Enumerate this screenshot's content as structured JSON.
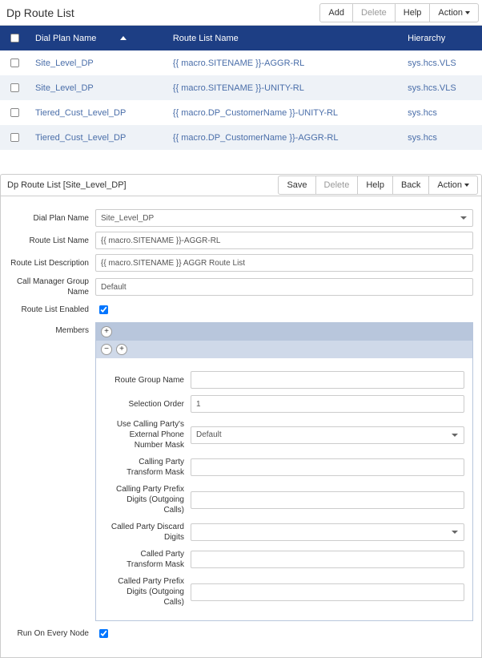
{
  "topbar": {
    "title": "Dp Route List",
    "buttons": {
      "add": "Add",
      "delete": "Delete",
      "help": "Help",
      "action": "Action"
    }
  },
  "grid": {
    "columns": {
      "dialPlan": "Dial Plan Name",
      "routeList": "Route List Name",
      "hierarchy": "Hierarchy"
    },
    "rows": [
      {
        "dialPlan": "Site_Level_DP",
        "routeList": "{{ macro.SITENAME }}-AGGR-RL",
        "hierarchy": "sys.hcs.VLS"
      },
      {
        "dialPlan": "Site_Level_DP",
        "routeList": "{{ macro.SITENAME }}-UNITY-RL",
        "hierarchy": "sys.hcs.VLS"
      },
      {
        "dialPlan": "Tiered_Cust_Level_DP",
        "routeList": "{{ macro.DP_CustomerName }}-UNITY-RL",
        "hierarchy": "sys.hcs"
      },
      {
        "dialPlan": "Tiered_Cust_Level_DP",
        "routeList": "{{ macro.DP_CustomerName }}-AGGR-RL",
        "hierarchy": "sys.hcs"
      }
    ]
  },
  "detailbar": {
    "title": "Dp Route List [Site_Level_DP]",
    "buttons": {
      "save": "Save",
      "delete": "Delete",
      "help": "Help",
      "back": "Back",
      "action": "Action"
    }
  },
  "form": {
    "labels": {
      "dialPlanName": "Dial Plan Name",
      "routeListName": "Route List Name",
      "routeListDesc": "Route List Description",
      "cmGroupName": "Call Manager Group Name",
      "routeListEnabled": "Route List Enabled",
      "members": "Members",
      "runEveryNode": "Run On Every Node"
    },
    "values": {
      "dialPlanName": "Site_Level_DP",
      "routeListName": "{{ macro.SITENAME }}-AGGR-RL",
      "routeListDesc": "{{ macro.SITENAME }} AGGR Route List",
      "cmGroupName": "Default"
    }
  },
  "members": {
    "labels": {
      "routeGroupName": "Route Group Name",
      "selectionOrder": "Selection Order",
      "useCallingParty": "Use Calling Party's External Phone Number Mask",
      "callingPartyTransform": "Calling Party Transform Mask",
      "callingPartyPrefix": "Calling Party Prefix Digits (Outgoing Calls)",
      "calledPartyDiscard": "Called Party Discard Digits",
      "calledPartyTransform": "Called Party Transform Mask",
      "calledPartyPrefix": "Called Party Prefix Digits (Outgoing Calls)"
    },
    "values": {
      "routeGroupName": "",
      "selectionOrder": "1",
      "useCallingParty": "Default",
      "callingPartyTransform": "",
      "callingPartyPrefix": "",
      "calledPartyDiscard": "",
      "calledPartyTransform": "",
      "calledPartyPrefix": ""
    }
  }
}
